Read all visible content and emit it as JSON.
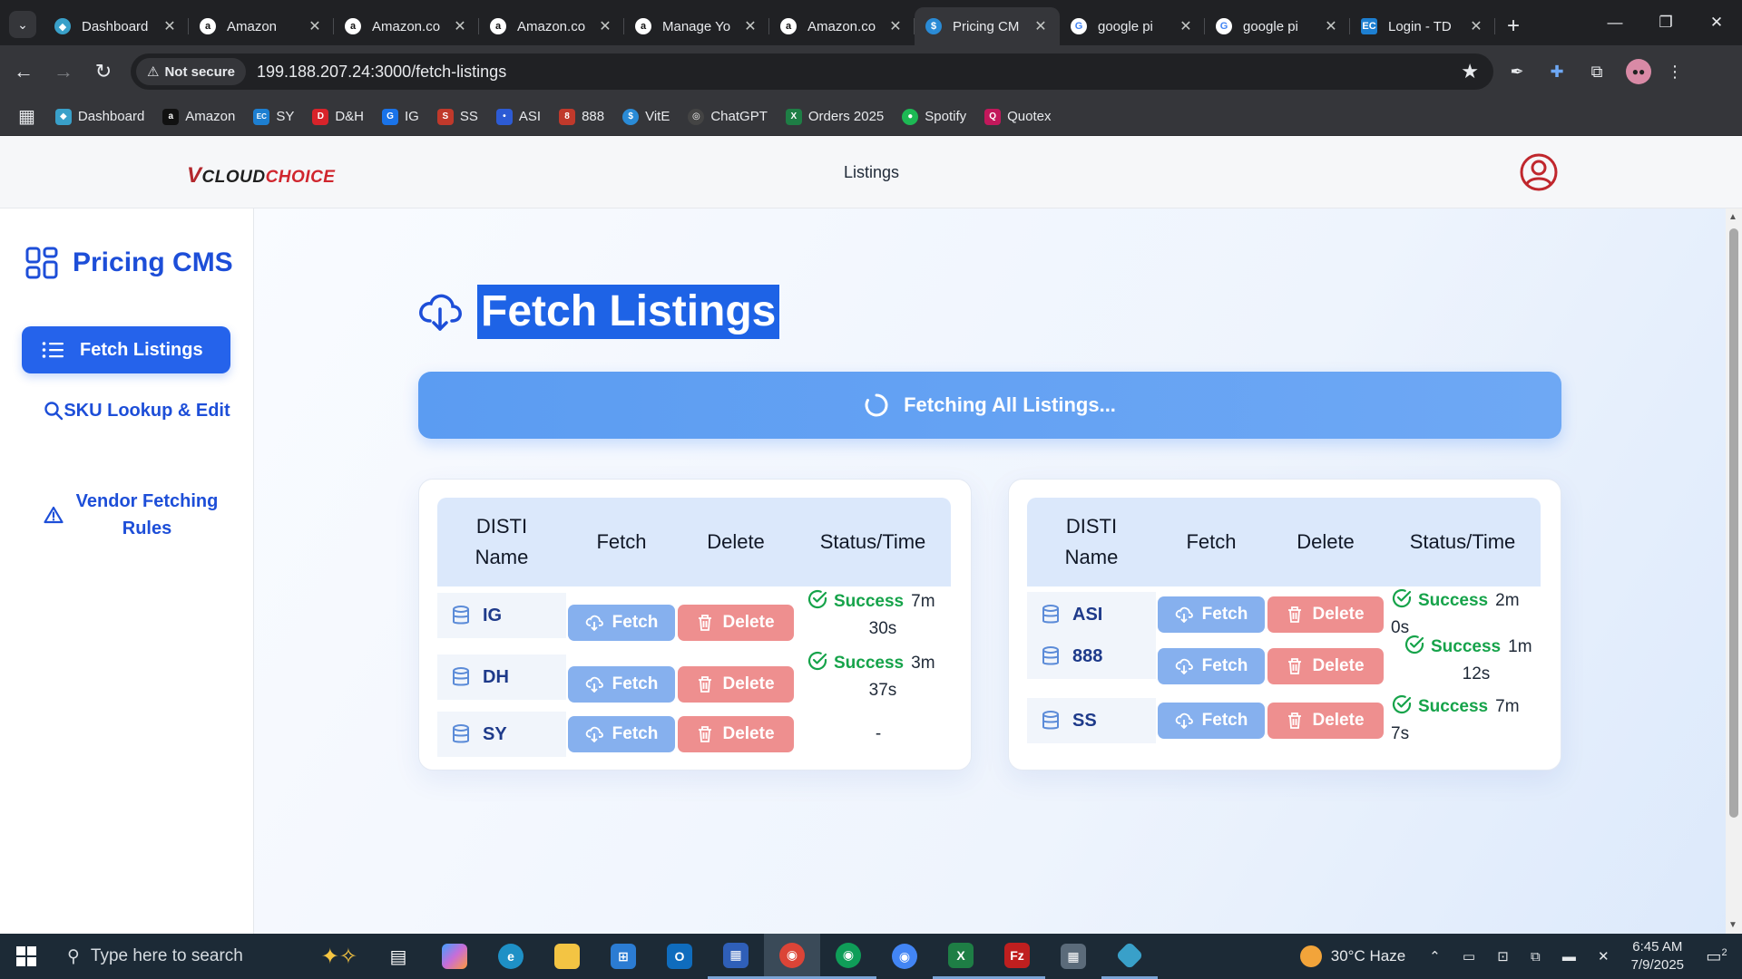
{
  "browser": {
    "tabs": [
      {
        "label": "Dashboard",
        "icon": "diamond-icon",
        "color": "#39a0c9"
      },
      {
        "label": "Amazon",
        "icon": "amazon-icon",
        "color": "#ffffff"
      },
      {
        "label": "Amazon.co",
        "icon": "amazon-icon",
        "color": "#ffffff"
      },
      {
        "label": "Amazon.co",
        "icon": "amazon-icon",
        "color": "#ffffff"
      },
      {
        "label": "Manage Yo",
        "icon": "amazon-icon",
        "color": "#ffffff"
      },
      {
        "label": "Amazon.co",
        "icon": "amazon-icon",
        "color": "#ffffff"
      },
      {
        "label": "Pricing CM",
        "icon": "dollar-icon",
        "color": "#2a8bd6",
        "active": true
      },
      {
        "label": "google pi",
        "icon": "google-icon",
        "color": "#ffffff"
      },
      {
        "label": "google pi",
        "icon": "google-icon",
        "color": "#ffffff"
      },
      {
        "label": "Login - TD",
        "icon": "ec-icon",
        "color": "#1d7fd1"
      }
    ],
    "security_label": "Not secure",
    "url": "199.188.207.24:3000/fetch-listings",
    "bookmarks": [
      {
        "label": "Dashboard",
        "badge": "◆",
        "color": "#39a0c9"
      },
      {
        "label": "Amazon",
        "badge": "a",
        "color": "#111111"
      },
      {
        "label": "SY",
        "badge": "EC",
        "color": "#1d7fd1"
      },
      {
        "label": "D&H",
        "badge": "D",
        "color": "#d8232a"
      },
      {
        "label": "IG",
        "badge": "G",
        "color": "#1a73e8"
      },
      {
        "label": "SS",
        "badge": "S",
        "color": "#c0392b"
      },
      {
        "label": "ASI",
        "badge": "•",
        "color": "#2d5bd4"
      },
      {
        "label": "888",
        "badge": "8",
        "color": "#c0392b"
      },
      {
        "label": "VitE",
        "badge": "$",
        "color": "#2a8bd6"
      },
      {
        "label": "ChatGPT",
        "badge": "◎",
        "color": "#444444"
      },
      {
        "label": "Orders 2025",
        "badge": "X",
        "color": "#1e7e45"
      },
      {
        "label": "Spotify",
        "badge": "●",
        "color": "#1db954"
      },
      {
        "label": "Quotex",
        "badge": "Q",
        "color": "#c2185b"
      }
    ]
  },
  "app": {
    "logo": {
      "v": "V",
      "cloud": "CLOUD",
      "choice": "CHOICE"
    },
    "nav_listings": "Listings",
    "brand": "Pricing CMS",
    "sidebar": [
      {
        "label": "Fetch Listings",
        "active": true
      },
      {
        "label": "SKU Lookup & Edit"
      },
      {
        "label": "Vendor Fetching Rules"
      }
    ],
    "page_title": "Fetch Listings",
    "fetch_all_label": "Fetching All Listings...",
    "table_headers": {
      "name": "DISTI Name",
      "fetch": "Fetch",
      "delete": "Delete",
      "status": "Status/Time"
    },
    "buttons": {
      "fetch": "Fetch",
      "delete": "Delete"
    },
    "left_rows": [
      {
        "name": "IG",
        "status": "Success",
        "time_a": "7m",
        "time_b": "30s"
      },
      {
        "name": "DH",
        "status": "Success",
        "time_a": "3m",
        "time_b": "37s"
      },
      {
        "name": "SY",
        "status": "",
        "time_a": "-",
        "time_b": ""
      }
    ],
    "right_rows": [
      {
        "name": "ASI",
        "status": "Success",
        "time_a": "2m 0s",
        "time_b": ""
      },
      {
        "name": "888",
        "status": "Success",
        "time_a": "1m",
        "time_b": "12s"
      },
      {
        "name": "SS",
        "status": "Success",
        "time_a": "7m 7s",
        "time_b": ""
      }
    ],
    "colors": {
      "primary": "#2563eb",
      "success": "#16a34a",
      "fetch_btn": "#86b0ee",
      "delete_btn": "#ee8f8f"
    }
  },
  "taskbar": {
    "search_placeholder": "Type here to search",
    "weather": "30°C  Haze",
    "time": "6:45 AM",
    "date": "7/9/2025",
    "notifications": "2"
  }
}
